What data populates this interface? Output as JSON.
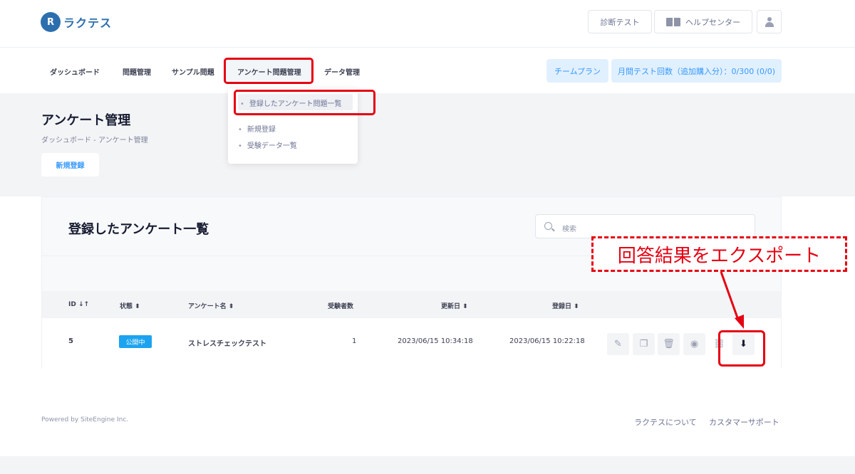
{
  "header": {
    "logo_mark": "R",
    "logo_text": "ラクテス",
    "diagnostic_test": "診断テスト",
    "help_center": "ヘルプセンター"
  },
  "nav": {
    "items": [
      "ダッシュボード",
      "問題管理",
      "サンプル問題",
      "アンケート問題管理",
      "データ管理"
    ],
    "team_plan": "チームプラン",
    "monthly_count": "月間テスト回数（追加購入分）：0/300 (0/0)"
  },
  "dropdown": {
    "items": [
      "登録したアンケート問題一覧",
      "新規登録",
      "受験データ一覧"
    ]
  },
  "subheader": {
    "title": "アンケート管理",
    "breadcrumb": "ダッシュボード - アンケート管理",
    "new_button": "新規登録"
  },
  "card": {
    "title": "登録したアンケート一覧",
    "search_placeholder": "検索"
  },
  "table": {
    "headers": [
      "ID ↓↑",
      "状態 ⬍",
      "アンケート名 ⬍",
      "受験者数",
      "更新日 ⬍",
      "登録日 ⬍"
    ],
    "rows": [
      {
        "id": "5",
        "status": "公開中",
        "name": "ストレスチェックテスト",
        "examinees": "1",
        "updated": "2023/06/15 10:34:18",
        "registered": "2023/06/15 10:22:18"
      }
    ],
    "action_icons": [
      "edit-icon",
      "copy-icon",
      "trash-icon",
      "view-icon",
      "link-icon",
      "download-icon"
    ]
  },
  "annotation": {
    "callout": "回答結果をエクスポート",
    "color": "#e50012"
  },
  "footer": {
    "powered_by": "Powered by SiteEngine Inc.",
    "about": "ラクテスについて",
    "support": "カスタマーサポート"
  },
  "colors": {
    "accent": "#3699ff",
    "brand": "#2d6fae",
    "badge": "#1ba3f0"
  }
}
